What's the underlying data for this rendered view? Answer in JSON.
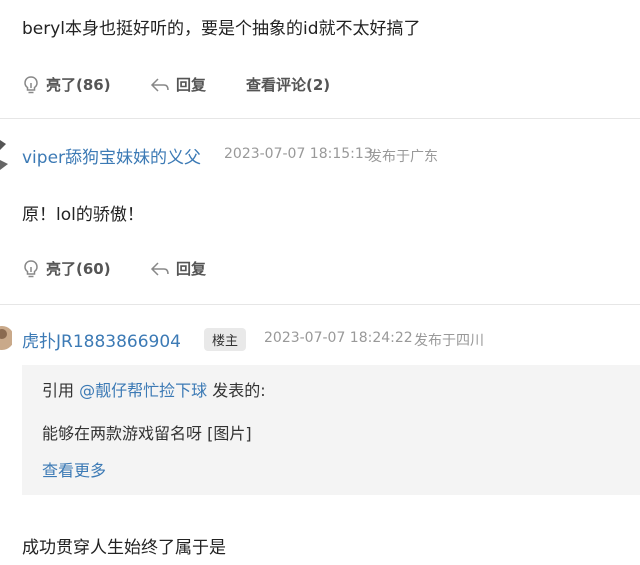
{
  "comment1": {
    "text": "beryl本身也挺好听的，要是个抽象的id就不太好搞了",
    "like_label": "亮了(86)",
    "reply_label": "回复",
    "view_comments_label": "查看评论(2)"
  },
  "comment2": {
    "username": "viper舔狗宝妹妹的义父",
    "timestamp": "2023-07-07 18:15:13",
    "location": "发布于广东",
    "text": "原！lol的骄傲！",
    "like_label": "亮了(60)",
    "reply_label": "回复"
  },
  "comment3": {
    "username": "虎扑JR1883866904",
    "badge": "楼主",
    "timestamp": "2023-07-07 18:24:22",
    "location": "发布于四川",
    "quote": {
      "prefix": "引用",
      "author": "@靓仔帮忙捡下球",
      "suffix": "发表的:",
      "text": "能够在两款游戏留名呀 [图片]",
      "more_label": "查看更多"
    },
    "text": "成功贯穿人生始终了属于是"
  },
  "colors": {
    "link": "#3c7ab5",
    "meta": "#999999",
    "quote_bg": "#f4f4f4"
  },
  "icons": {
    "like": "lightbulb-icon",
    "reply": "reply-arrow-icon"
  }
}
